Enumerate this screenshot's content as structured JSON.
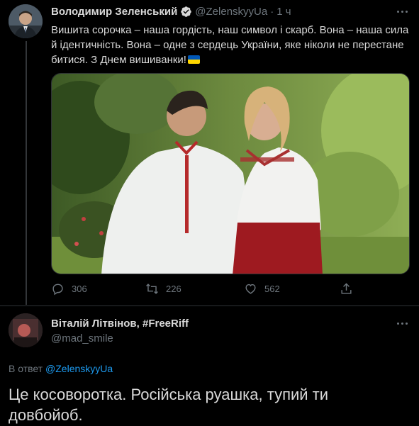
{
  "tweet": {
    "author_name": "Володимир Зеленський",
    "handle": "@ZelenskyyUa",
    "separator": "·",
    "time": "1 ч",
    "text": "Вишита сорочка – наша гордість, наш символ і скарб. Вона – наша сила й ідентичність. Вона – одне з сердець України, яке ніколи не перестане битися. З Днем вишиванки!",
    "flag_colors": [
      "#0057b7",
      "#ffd700"
    ],
    "actions": {
      "replies": "306",
      "retweets": "226",
      "likes": "562"
    },
    "icons": [
      "verified-badge-icon",
      "more-icon",
      "reply-icon",
      "retweet-icon",
      "like-icon",
      "share-icon"
    ]
  },
  "reply": {
    "author_name": "Віталій Літвінов, #FreeRiff",
    "handle": "@mad_smile",
    "reply_prefix": "В ответ",
    "reply_to": "@ZelenskyyUa",
    "text": "Це косоворотка. Російська руашка, тупий ти довбойоб."
  },
  "colors": {
    "background": "#000000",
    "text": "#d9d9d9",
    "secondary": "#6e767d",
    "accent": "#1d9bf0",
    "border": "#2f3336"
  }
}
